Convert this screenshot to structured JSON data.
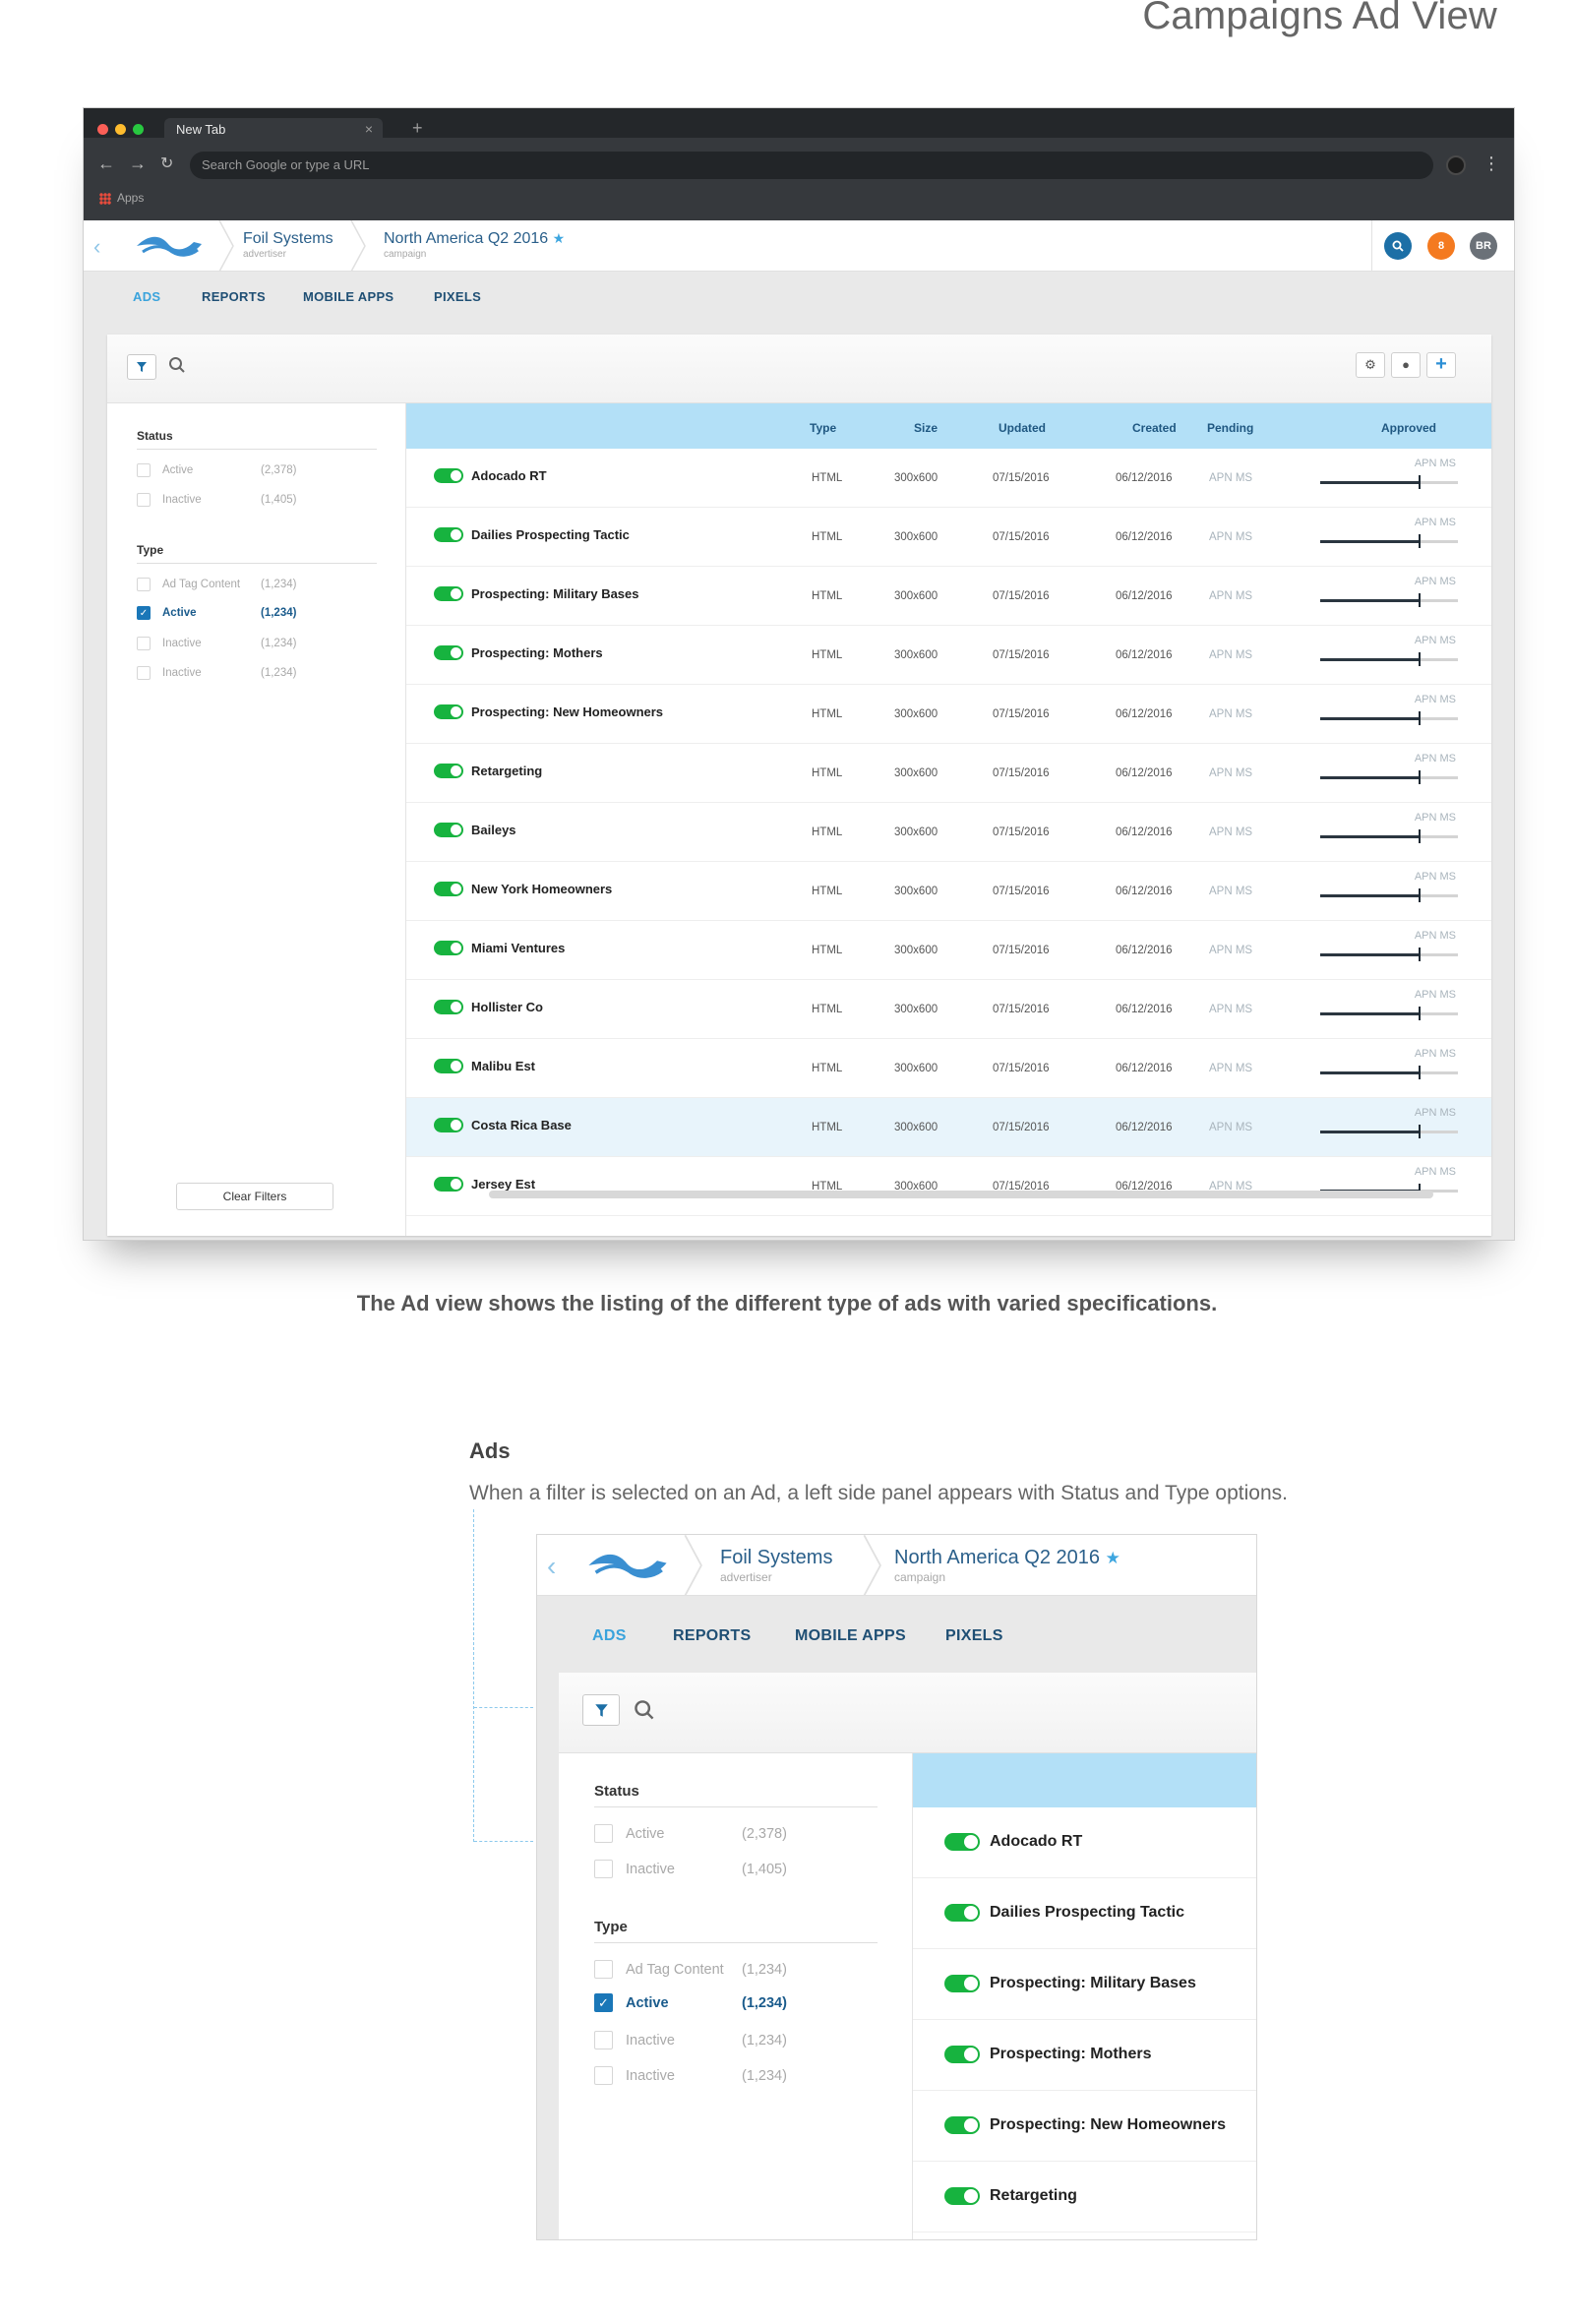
{
  "page_title": "Campaigns Ad View",
  "browser": {
    "tab_title": "New Tab",
    "tab_close": "×",
    "new_tab": "+",
    "omnibox_placeholder": "Search Google or type a URL",
    "bookmarks_label": "Apps"
  },
  "header": {
    "advertiser_name": "Foil Systems",
    "advertiser_label": "advertiser",
    "campaign_name": "North America Q2 2016",
    "campaign_label": "campaign",
    "notification_count": "8",
    "user_initials": "BR"
  },
  "nav_tabs": [
    {
      "label": "ADS",
      "active": true
    },
    {
      "label": "REPORTS",
      "active": false
    },
    {
      "label": "MOBILE APPS",
      "active": false
    },
    {
      "label": "PIXELS",
      "active": false
    }
  ],
  "filters": {
    "status_title": "Status",
    "status": [
      {
        "label": "Active",
        "count": "(2,378)",
        "checked": false
      },
      {
        "label": "Inactive",
        "count": "(1,405)",
        "checked": false
      }
    ],
    "type_title": "Type",
    "type": [
      {
        "label": "Ad Tag Content",
        "count": "(1,234)",
        "checked": false
      },
      {
        "label": "Active",
        "count": "(1,234)",
        "checked": true
      },
      {
        "label": "Inactive",
        "count": "(1,234)",
        "checked": false
      },
      {
        "label": "Inactive",
        "count": "(1,234)",
        "checked": false
      }
    ],
    "clear_label": "Clear Filters"
  },
  "table": {
    "columns": [
      "Type",
      "Size",
      "Updated",
      "Created",
      "Pending",
      "Approved"
    ],
    "rows": [
      {
        "name": "Adocado RT",
        "type": "HTML",
        "size": "300x600",
        "updated": "07/15/2016",
        "created": "06/12/2016",
        "pending": "APN MS",
        "approved": "APN MS",
        "approval": 0.72
      },
      {
        "name": "Dailies Prospecting Tactic",
        "type": "HTML",
        "size": "300x600",
        "updated": "07/15/2016",
        "created": "06/12/2016",
        "pending": "APN MS",
        "approved": "APN MS",
        "approval": 0.72
      },
      {
        "name": "Prospecting: Military Bases",
        "type": "HTML",
        "size": "300x600",
        "updated": "07/15/2016",
        "created": "06/12/2016",
        "pending": "APN MS",
        "approved": "APN MS",
        "approval": 0.72
      },
      {
        "name": "Prospecting: Mothers",
        "type": "HTML",
        "size": "300x600",
        "updated": "07/15/2016",
        "created": "06/12/2016",
        "pending": "APN MS",
        "approved": "APN MS",
        "approval": 0.72
      },
      {
        "name": "Prospecting: New Homeowners",
        "type": "HTML",
        "size": "300x600",
        "updated": "07/15/2016",
        "created": "06/12/2016",
        "pending": "APN MS",
        "approved": "APN MS",
        "approval": 0.72
      },
      {
        "name": "Retargeting",
        "type": "HTML",
        "size": "300x600",
        "updated": "07/15/2016",
        "created": "06/12/2016",
        "pending": "APN MS",
        "approved": "APN MS",
        "approval": 0.72
      },
      {
        "name": "Baileys",
        "type": "HTML",
        "size": "300x600",
        "updated": "07/15/2016",
        "created": "06/12/2016",
        "pending": "APN MS",
        "approved": "APN MS",
        "approval": 0.72
      },
      {
        "name": "New York Homeowners",
        "type": "HTML",
        "size": "300x600",
        "updated": "07/15/2016",
        "created": "06/12/2016",
        "pending": "APN MS",
        "approved": "APN MS",
        "approval": 0.72
      },
      {
        "name": "Miami Ventures",
        "type": "HTML",
        "size": "300x600",
        "updated": "07/15/2016",
        "created": "06/12/2016",
        "pending": "APN MS",
        "approved": "APN MS",
        "approval": 0.72
      },
      {
        "name": "Hollister Co",
        "type": "HTML",
        "size": "300x600",
        "updated": "07/15/2016",
        "created": "06/12/2016",
        "pending": "APN MS",
        "approved": "APN MS",
        "approval": 0.72
      },
      {
        "name": "Malibu Est",
        "type": "HTML",
        "size": "300x600",
        "updated": "07/15/2016",
        "created": "06/12/2016",
        "pending": "APN MS",
        "approved": "APN MS",
        "approval": 0.72
      },
      {
        "name": "Costa Rica Base",
        "type": "HTML",
        "size": "300x600",
        "updated": "07/15/2016",
        "created": "06/12/2016",
        "pending": "APN MS",
        "approved": "APN MS",
        "approval": 0.72,
        "highlight": true
      },
      {
        "name": "Jersey Est",
        "type": "HTML",
        "size": "300x600",
        "updated": "07/15/2016",
        "created": "06/12/2016",
        "pending": "APN MS",
        "approved": "APN MS",
        "approval": 0.72
      }
    ]
  },
  "caption": "The Ad view shows the listing of the different type of ads with varied specifications.",
  "section": {
    "title": "Ads",
    "description": "When a filter is selected on an Ad, a left side panel appears with Status and Type options."
  },
  "zoom_rows": [
    "Adocado RT",
    "Dailies Prospecting Tactic",
    "Prospecting: Military Bases",
    "Prospecting: Mothers",
    "Prospecting: New Homeowners",
    "Retargeting"
  ],
  "colors": {
    "accent": "#3aa3dc",
    "nav_text": "#1f4f74",
    "toggle_on": "#17b33f",
    "table_header": "#b3e0f7",
    "badge_search": "#1c6fa6",
    "badge_notifications": "#f47a20",
    "badge_user": "#6b7178"
  }
}
